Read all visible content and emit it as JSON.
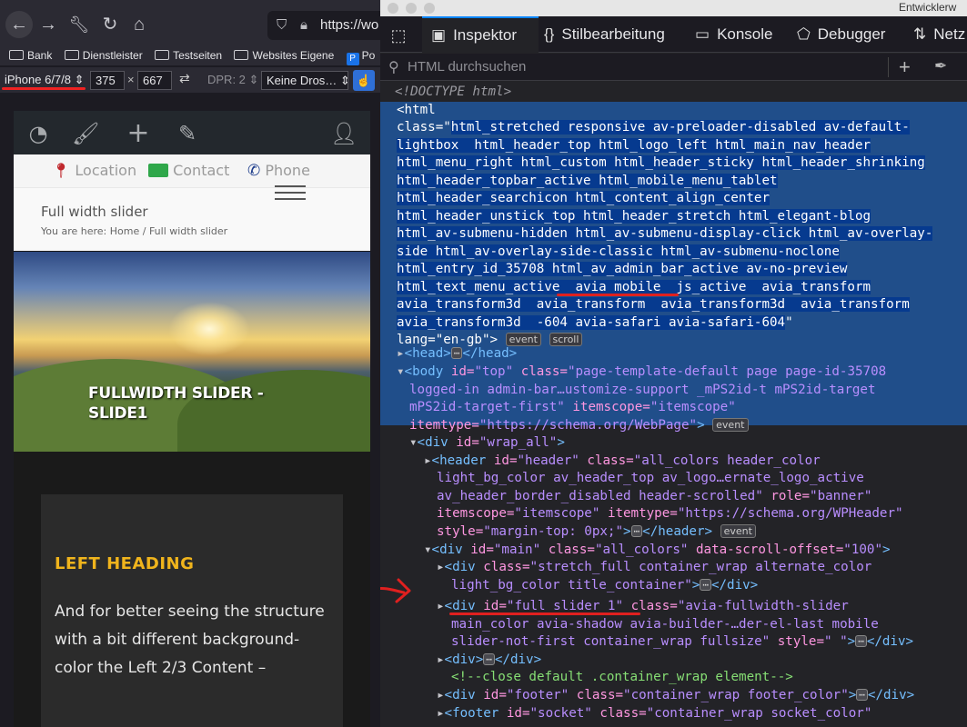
{
  "browser": {
    "url": "https://wo",
    "bookmarks": [
      "Bank",
      "Dienstleister",
      "Testseiten",
      "Websites Eigene",
      "Po"
    ],
    "rdm": {
      "device": "iPhone 6/7/8 ⇕",
      "width": "375",
      "times": "×",
      "height": "667",
      "dpr": "DPR: 2 ⇕",
      "throttle": "Keine Dros… ⇕"
    }
  },
  "site": {
    "contact": {
      "location": "Location",
      "contact": "Contact",
      "phone": "Phone"
    },
    "page_title": "Full width slider",
    "breadcrumb": {
      "prefix": "You are here:",
      "home": "Home",
      "sep": "/",
      "current": "Full width slider"
    },
    "slide_caption": "FULLWIDTH SLIDER - SLIDE1",
    "left_heading": "LEFT HEADING",
    "left_text": "And for better seeing the structure with a bit different background-color the Left 2/3 Content –"
  },
  "devtools": {
    "window_title": "Entwicklerw",
    "tabs": {
      "inspector": "Inspektor",
      "style_editor": "Stilbearbeitung",
      "console": "Konsole",
      "debugger": "Debugger",
      "network": "Netz"
    },
    "search_placeholder": "HTML durchsuchen",
    "doctype": "<!DOCTYPE html>",
    "html_lines": [
      "html_stretched responsive av-preloader-disabled av-default-",
      "lightbox  html_header_top html_logo_left html_main_nav_header",
      "html_menu_right html_custom html_header_sticky html_header_shrinking",
      "html_header_topbar_active html_mobile_menu_tablet",
      "html_header_searchicon html_content_align_center",
      "html_header_unstick_top html_header_stretch html_elegant-blog",
      "html_av-submenu-hidden html_av-submenu-display-click html_av-overlay-",
      "side html_av-overlay-side-classic html_av-submenu-noclone",
      "html_entry_id_35708 html_av_admin_bar_active av-no-preview"
    ],
    "html_line10_pre": "html_text_menu_active  ",
    "html_line10_hl": "avia mobile",
    "html_line10_post": "  js_active  avia_transform",
    "html_line11": "avia_transform3d  avia_transform  avia_transform3d  avia_transform",
    "html_line12": "avia_transform3d  -604 avia-safari avia-safari-604",
    "lang_value": "en-gb",
    "badge_event": "event",
    "badge_scroll": "scroll",
    "body_lines": [
      "page-template-default page page-id-35708",
      "logged-in admin-bar…ustomize-support _mPS2id-t mPS2id-target",
      "mPS2id-target-first"
    ],
    "body_itemtype": "https://schema.org/WebPage",
    "header_lines": [
      "all_colors header_color",
      "light_bg_color av_header_top av_logo…ernate_logo_active",
      "av_header_border_disabled header-scrolled"
    ],
    "header_itemtype": "https://schema.org/WPHeader",
    "main_offset": "100",
    "stretch_lines": [
      "stretch_full container_wrap alternate_color",
      "light_bg_color title_container"
    ],
    "slider_id": "full_slider_1",
    "slider_lines": [
      "avia-fullwidth-slider",
      "main_color avia-shadow avia-builder-…der-el-last mobile",
      "slider-not-first container_wrap fullsize"
    ],
    "comment": "<!--close default .container_wrap element-->",
    "footer_class": "container_wrap footer_color",
    "socket_class": "container_wrap socket_color"
  },
  "colors": {
    "selection": "#204e8a",
    "accent_blue": "#0a84ff",
    "annotation_red": "#e0201f",
    "heading_yellow": "#f0b41c"
  }
}
